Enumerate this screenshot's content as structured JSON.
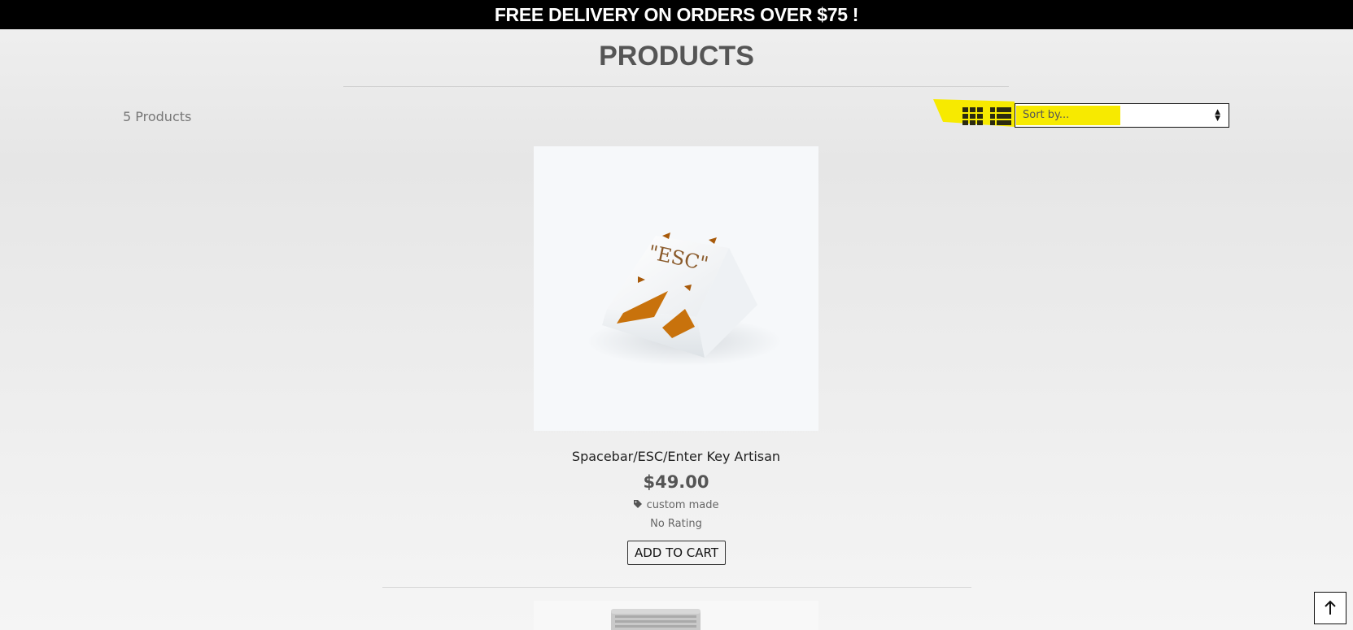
{
  "announcement": "FREE DELIVERY ON ORDERS OVER $75 !",
  "page": {
    "title": "PRODUCTS"
  },
  "toolbar": {
    "count": "5 Products",
    "view_modes": [
      "grid-icon",
      "list-icon"
    ],
    "sort": {
      "placeholder": "Sort by..."
    },
    "highlight_color": "#f7ea00"
  },
  "products": [
    {
      "name": "Spacebar/ESC/Enter Key Artisan",
      "price": "$49.00",
      "tag": "custom made",
      "rating": "No Rating",
      "cart_label": "ADD TO CART",
      "image_text": "\"ESC\""
    }
  ],
  "colors": {
    "announcement_bg": "#000000",
    "accent_orange": "#c8720c"
  }
}
